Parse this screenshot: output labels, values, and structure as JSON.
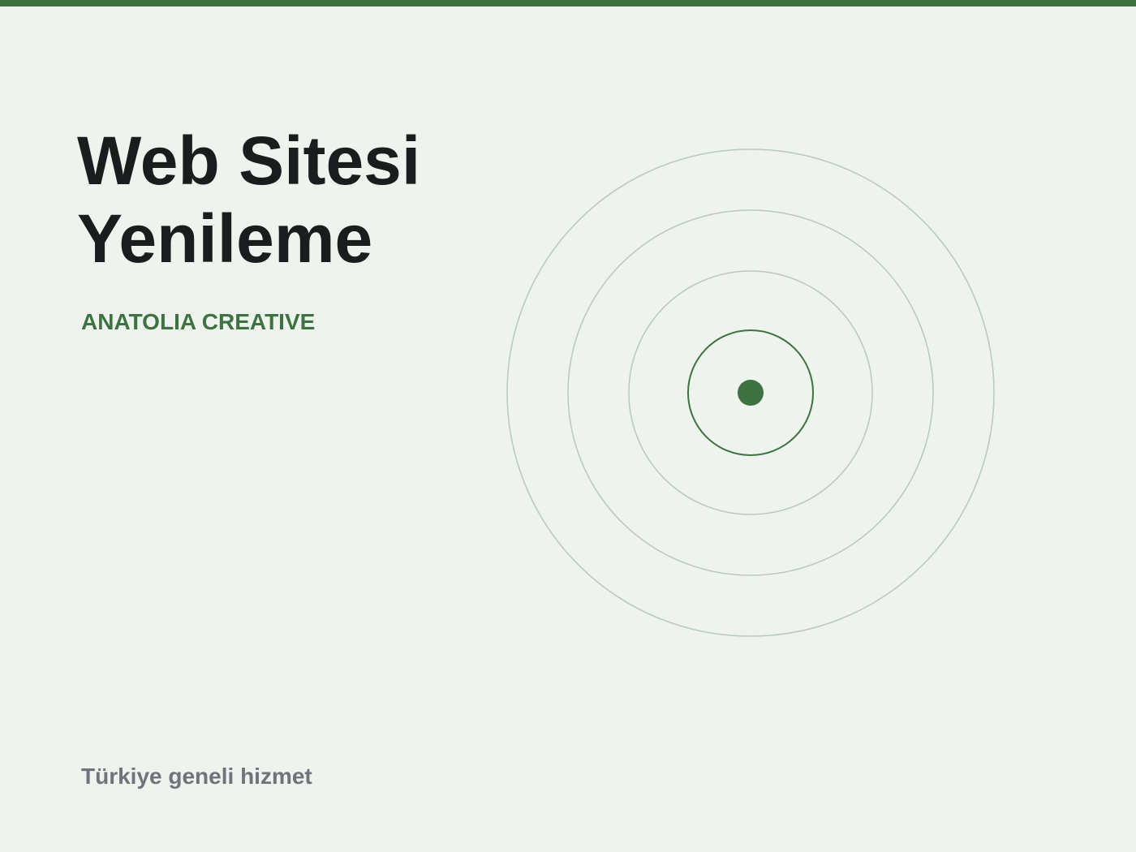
{
  "slide": {
    "title_line_1": "Web Sitesi",
    "title_line_2": "Yenileme",
    "brand": "ANATOLIA CREATIVE",
    "footer_note": "Türkiye geneli hizmet"
  },
  "decoration": {
    "icon": "concentric-rings-icon"
  },
  "colors": {
    "background": "#eef3ed",
    "accent": "#3e7242",
    "title": "#1b1c1d",
    "muted_text": "#6f737b",
    "ring_light": "#b8c9bb"
  }
}
